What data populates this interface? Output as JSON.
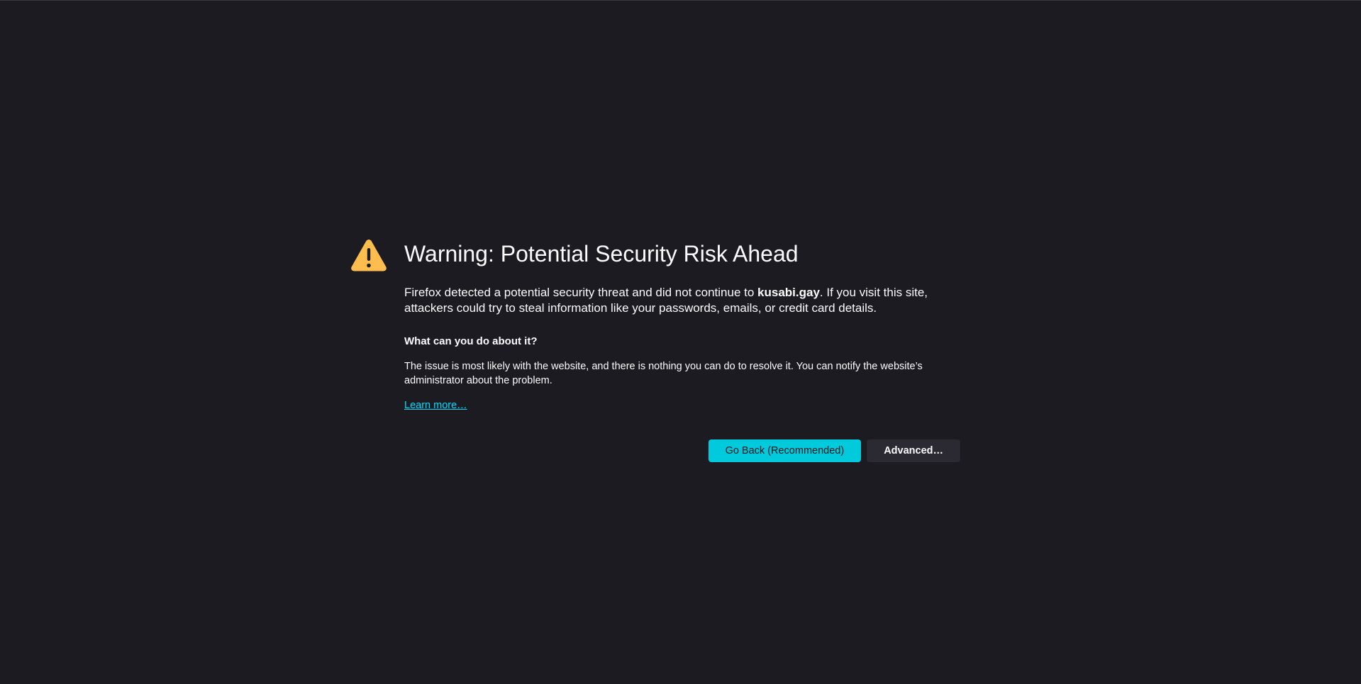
{
  "page": {
    "title": "Warning: Potential Security Risk Ahead",
    "description_prefix": "Firefox detected a potential security threat and did not continue to ",
    "site": "kusabi.gay",
    "description_suffix": ". If you visit this site, attackers could try to steal information like your passwords, emails, or credit card details.",
    "subheading": "What can you do about it?",
    "issue_text": "The issue is most likely with the website, and there is nothing you can do to resolve it. You can notify the website’s administrator about the problem.",
    "learn_more": "Learn more…"
  },
  "buttons": {
    "go_back": "Go Back (Recommended)",
    "advanced": "Advanced…"
  },
  "icons": {
    "warning": "warning-triangle-icon"
  },
  "colors": {
    "background": "#1c1b22",
    "text": "#fbfbfe",
    "accent": "#00cadb",
    "link": "#00ddff",
    "warning": "#ffbd4f",
    "secondary_button": "#2b2a33"
  }
}
